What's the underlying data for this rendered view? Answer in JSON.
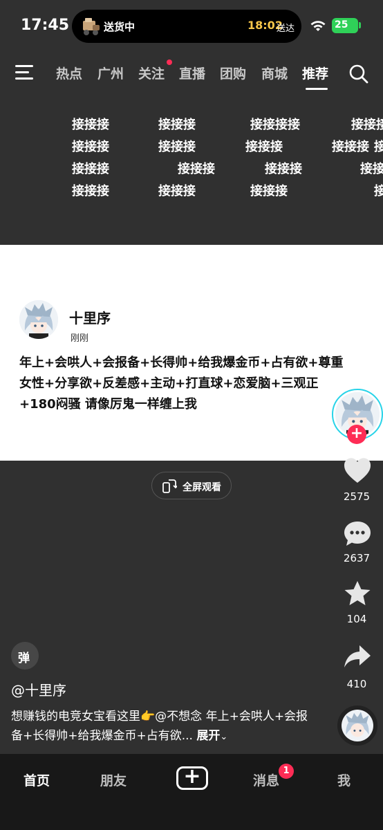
{
  "status_bar": {
    "time": "17:45",
    "island_left": "送货中",
    "island_time": "18:02",
    "island_right": "送达",
    "battery": "25"
  },
  "top_nav": {
    "tabs": [
      "热点",
      "广州",
      "关注",
      "直播",
      "团购",
      "商城",
      "推荐"
    ],
    "active_tab": "推荐"
  },
  "watermark_rows": [
    [
      "接接接",
      "接接接",
      "接接接接",
      "接接接"
    ],
    [
      "接接接",
      "接接接",
      "接接接",
      "接接接",
      "接"
    ],
    [
      "接接接",
      "接接接",
      "接接接",
      "接接"
    ],
    [
      "接接接",
      "接接接",
      "接接接",
      "接"
    ]
  ],
  "card": {
    "name": "十里序",
    "time": "刚刚",
    "text": "年上+会哄人+会报备+长得帅+给我爆金币+占有欲+尊重女性+分享欲+反差感+主动+打直球+恋爱脑+三观正+180闷骚 请像厉鬼一样缠上我"
  },
  "fullscreen_label": "全屏观看",
  "actions": {
    "likes": "2575",
    "comments": "2637",
    "favorites": "104",
    "shares": "410"
  },
  "danmu_label": "弹",
  "video": {
    "author": "@十里序",
    "description": "想赚钱的电竞女宝看这里👉@不想念 年上+会哄人+会报备+长得帅+给我爆金币+占有欲...",
    "expand": "展开"
  },
  "bottom_tabs": {
    "home": "首页",
    "friends": "朋友",
    "plus": "+",
    "messages": "消息",
    "messages_badge": "1",
    "me": "我"
  },
  "colors": {
    "background": "#303030",
    "accent_red": "#fe2c55",
    "battery_green": "#2fd158",
    "island_time": "#f6c64a"
  }
}
